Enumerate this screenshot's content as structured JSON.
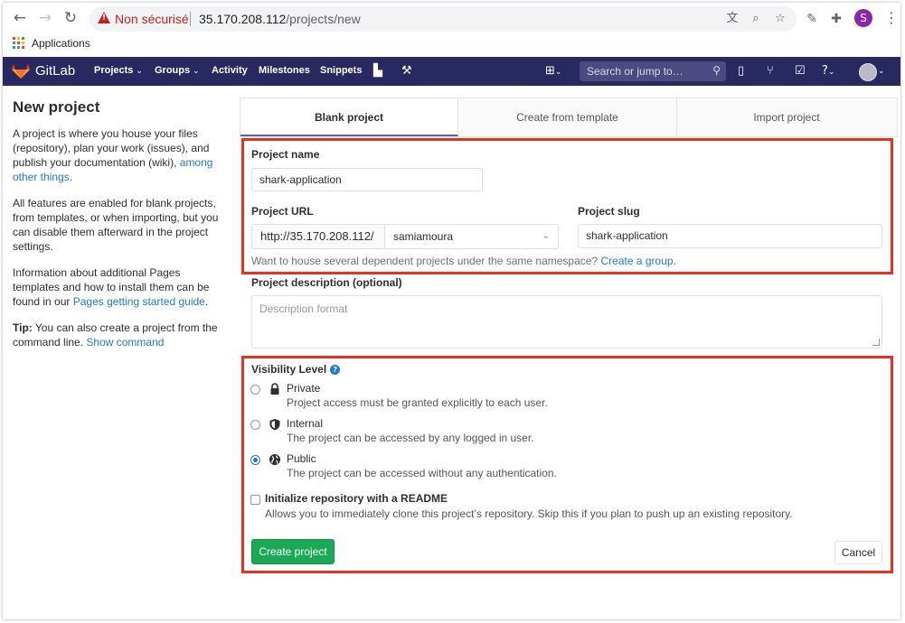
{
  "browser": {
    "insecure_label": "Non sécurisé",
    "url_host": "35.170.208.112",
    "url_path": "/projects/new",
    "bookmark_apps_label": "Applications",
    "profile_initial": "S"
  },
  "header": {
    "brand": "GitLab",
    "nav": [
      {
        "label": "Projects",
        "dropdown": true
      },
      {
        "label": "Groups",
        "dropdown": true
      },
      {
        "label": "Activity",
        "dropdown": false
      },
      {
        "label": "Milestones",
        "dropdown": false
      },
      {
        "label": "Snippets",
        "dropdown": false
      }
    ],
    "search_placeholder": "Search or jump to…",
    "colors": {
      "header_bg": "#292961",
      "logo_orange": "#fc6d26"
    }
  },
  "left": {
    "title": "New project",
    "p1_text": "A project is where you house your files (repository), plan your work (issues), and publish your documentation (wiki),",
    "p1_link": "among other things",
    "p1_end": ".",
    "p2": "All features are enabled for blank projects, from templates, or when importing, but you can disable them afterward in the project settings.",
    "p3_text": "Information about additional Pages templates and how to install them can be found in our",
    "p3_link": "Pages getting started guide",
    "p3_end": ".",
    "tip_label": "Tip:",
    "tip_text": "You can also create a project from the command line.",
    "tip_link": "Show command"
  },
  "tabs": [
    "Blank project",
    "Create from template",
    "Import project"
  ],
  "form": {
    "project_name_label": "Project name",
    "project_name_value": "shark-application",
    "project_url_label": "Project URL",
    "url_prefix": "http://35.170.208.112/",
    "namespace_value": "samiamoura",
    "project_slug_label": "Project slug",
    "project_slug_value": "shark-application",
    "namespace_hint": "Want to house several dependent projects under the same namespace?",
    "namespace_hint_link": "Create a group.",
    "description_label": "Project description (optional)",
    "description_placeholder": "Description format",
    "visibility_label": "Visibility Level",
    "visibility_options": [
      {
        "title": "Private",
        "desc": "Project access must be granted explicitly to each user.",
        "icon": "lock-icon",
        "checked": false
      },
      {
        "title": "Internal",
        "desc": "The project can be accessed by any logged in user.",
        "icon": "shield-icon",
        "checked": false
      },
      {
        "title": "Public",
        "desc": "The project can be accessed without any authentication.",
        "icon": "globe-icon",
        "checked": true
      }
    ],
    "readme_label": "Initialize repository with a README",
    "readme_desc": "Allows you to immediately clone this project’s repository. Skip this if you plan to push up an existing repository.",
    "readme_checked": false,
    "create_button": "Create project",
    "cancel_button": "Cancel"
  },
  "colors": {
    "highlight_red": "#e8321f",
    "link_blue": "#1f78d1",
    "create_green": "#1aaa55"
  }
}
